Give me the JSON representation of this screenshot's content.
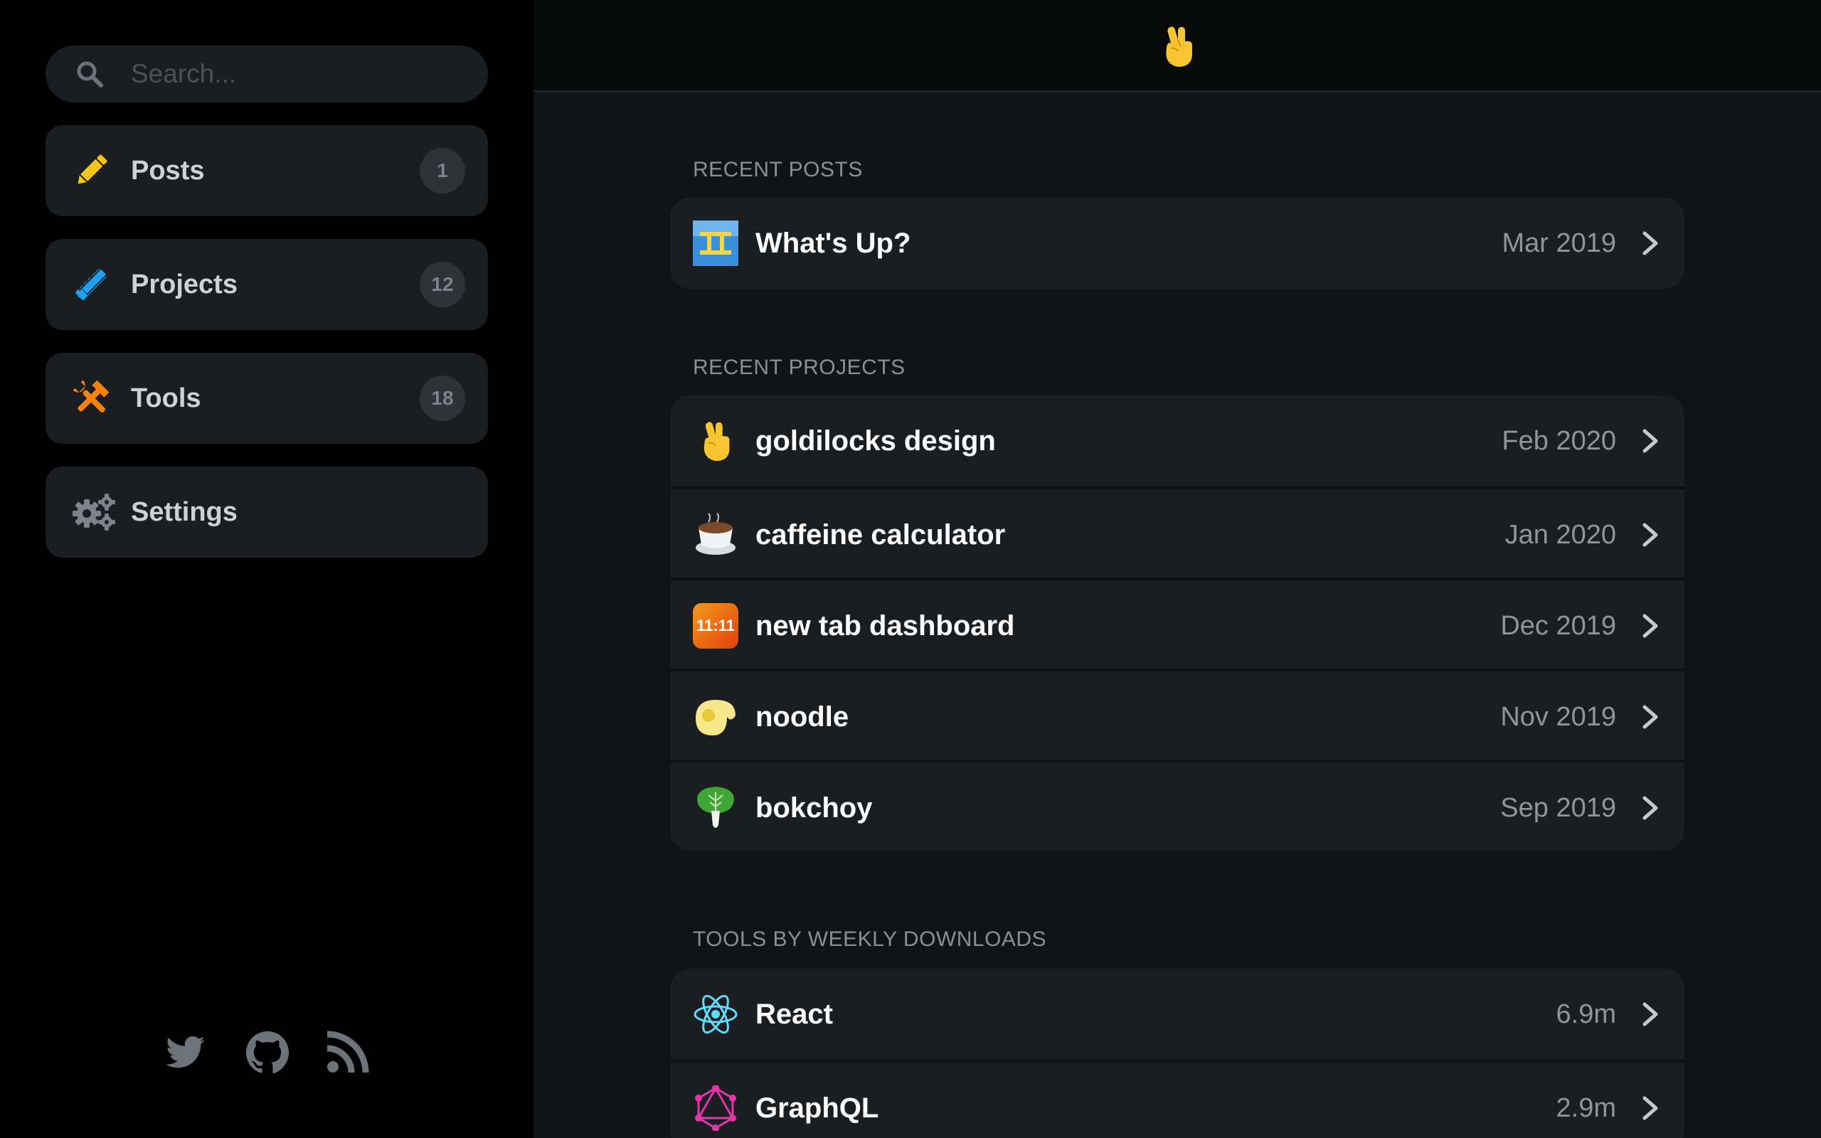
{
  "sidebar": {
    "search": {
      "placeholder": "Search..."
    },
    "nav": [
      {
        "label": "Posts",
        "count": "1",
        "icon": "pencil-icon"
      },
      {
        "label": "Projects",
        "count": "12",
        "icon": "pencil-ruler-icon"
      },
      {
        "label": "Tools",
        "count": "18",
        "icon": "tools-icon"
      },
      {
        "label": "Settings",
        "icon": "gears-icon"
      }
    ],
    "social": [
      "twitter-icon",
      "github-icon",
      "rss-icon"
    ]
  },
  "header": {
    "logo": "crossed-fingers-icon"
  },
  "sections": {
    "posts": {
      "title": "RECENT POSTS",
      "items": [
        {
          "title": "What's Up?",
          "meta": "Mar 2019",
          "icon": "post-thumbnail-icon"
        }
      ]
    },
    "projects": {
      "title": "RECENT PROJECTS",
      "items": [
        {
          "title": "goldilocks design",
          "meta": "Feb 2020",
          "icon": "crossed-fingers-icon"
        },
        {
          "title": "caffeine calculator",
          "meta": "Jan 2020",
          "icon": "coffee-cup-icon"
        },
        {
          "title": "new tab dashboard",
          "meta": "Dec 2019",
          "icon": "clock-1111-icon",
          "icon_text": "11:11"
        },
        {
          "title": "noodle",
          "meta": "Nov 2019",
          "icon": "noodle-icon"
        },
        {
          "title": "bokchoy",
          "meta": "Sep 2019",
          "icon": "bokchoy-icon"
        }
      ]
    },
    "tools": {
      "title": "TOOLS BY WEEKLY DOWNLOADS",
      "items": [
        {
          "title": "React",
          "meta": "6.9m",
          "icon": "react-icon"
        },
        {
          "title": "GraphQL",
          "meta": "2.9m",
          "icon": "graphql-icon"
        }
      ]
    }
  },
  "colors": {
    "background": "#000000",
    "main_background": "#111315",
    "card": "#1b1e21",
    "posts_accent": "#f5c518",
    "projects_accent": "#1da1f2",
    "tools_accent": "#f5820d",
    "react": "#61dafb",
    "graphql": "#e535ab"
  }
}
